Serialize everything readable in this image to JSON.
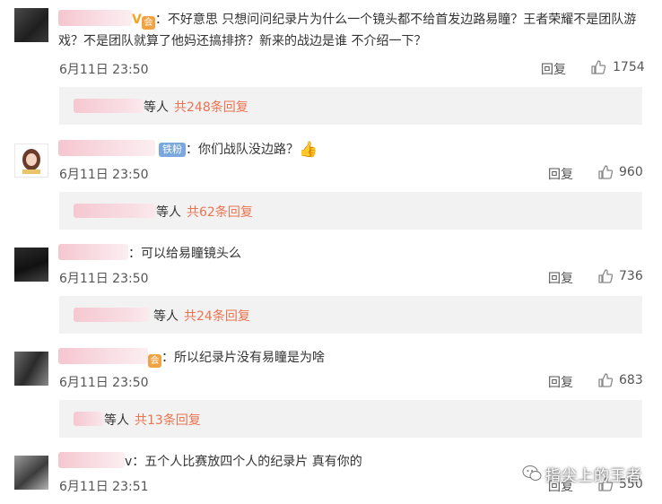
{
  "comments": [
    {
      "text": "：不好意思  只想问问纪录片为什么一个镜头都不给首发边路易瞳？王者荣耀不是团队游戏？不是团队就算了他妈还搞排挤？新来的战边是谁   不介绍一下？",
      "name_suffix": "V",
      "time": "6月11日 23:50",
      "reply": "回复",
      "likes": "1754",
      "sub": {
        "deng": "等人",
        "total": "共248条回复"
      }
    },
    {
      "badge": "铁粉",
      "text": "：你们战队没边路？",
      "time": "6月11日 23:50",
      "reply": "回复",
      "likes": "960",
      "sub": {
        "deng": "等人",
        "total": "共62条回复"
      }
    },
    {
      "text": "：可以给易瞳镜头么",
      "time": "6月11日 23:50",
      "reply": "回复",
      "likes": "736",
      "sub": {
        "deng": "等人",
        "total": "共24条回复"
      }
    },
    {
      "text": "：所以纪录片没有易瞳是为啥",
      "time": "6月11日 23:50",
      "reply": "回复",
      "likes": "683",
      "sub": {
        "deng": "等人",
        "total": "共13条回复"
      }
    },
    {
      "name_suffix": "v",
      "text": "：五个人比赛放四个人的纪录片 真有你的",
      "time": "6月11日 23:51",
      "reply": "回复",
      "likes": "550"
    }
  ],
  "watermark": "指尖上的王者",
  "icons": {
    "like": "thumbs-up-icon",
    "watermark": "wechat-icon"
  },
  "colors": {
    "accent": "#eb7350",
    "badge": "#7aa7dd"
  }
}
